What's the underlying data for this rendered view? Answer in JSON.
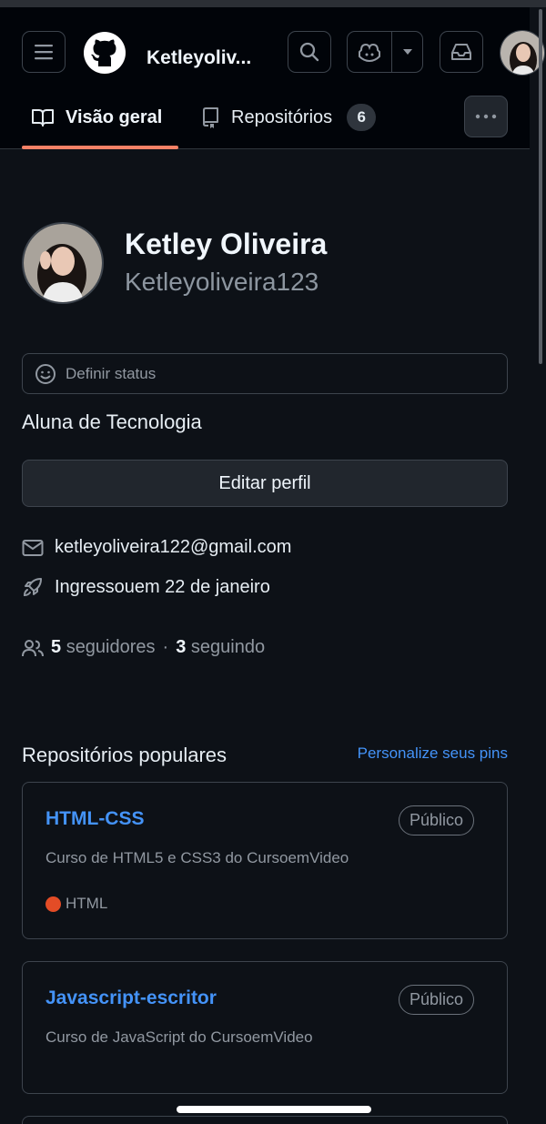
{
  "header": {
    "username": "Ketleyoliv...",
    "tabs": [
      {
        "label": "Visão geral"
      },
      {
        "label": "Repositórios",
        "count": "6"
      }
    ]
  },
  "profile": {
    "name": "Ketley Oliveira",
    "login": "Ketleyoliveira123",
    "status_label": "Definir status",
    "bio": "Aluna de Tecnologia",
    "edit_label": "Editar perfil",
    "email": "ketleyoliveira122@gmail.com",
    "joined": "Ingressouem 22 de janeiro",
    "followers_count": "5",
    "followers_label": "seguidores",
    "separator": "·",
    "following_count": "3",
    "following_label": "seguindo"
  },
  "popular": {
    "title": "Repositórios populares",
    "customize_label": "Personalize seus pins",
    "repos": [
      {
        "name": "HTML-CSS",
        "visibility": "Público",
        "description": "Curso de HTML5 e CSS3 do CursoemVideo",
        "language": "HTML",
        "language_color": "#e34c26"
      },
      {
        "name": "Javascript-escritor",
        "visibility": "Público",
        "description": "Curso de JavaScript do CursoemVideo"
      }
    ]
  },
  "colors": {
    "accent": "#f78166",
    "link": "#4493f8",
    "background": "#0d1117",
    "header": "#010409"
  }
}
